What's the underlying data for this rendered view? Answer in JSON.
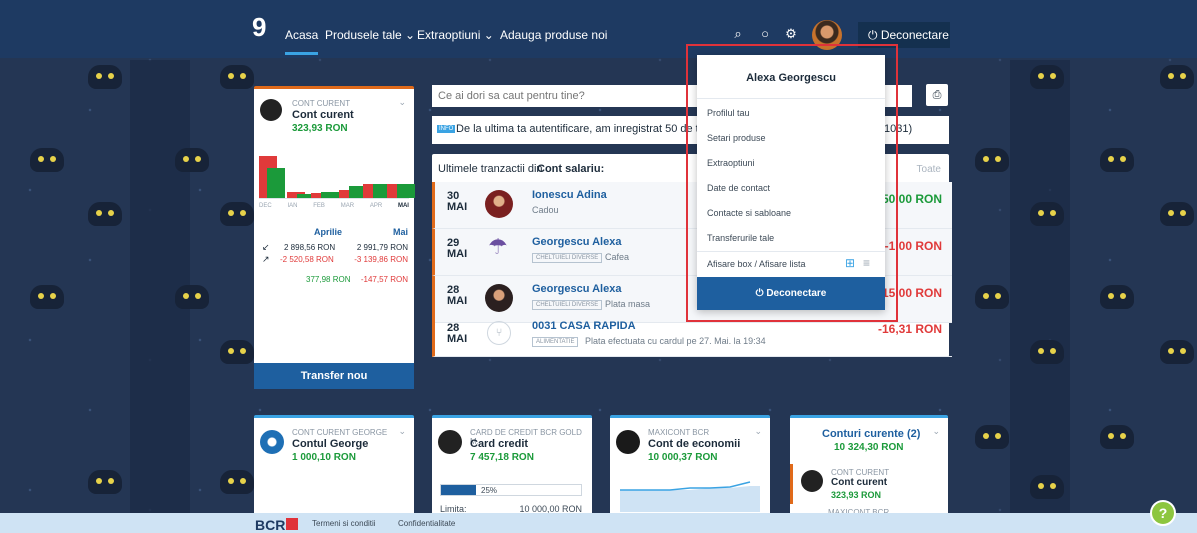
{
  "nav": {
    "home": "Acasa",
    "products": "Produsele tale ⌄",
    "extra": "Extraoptiuni ⌄",
    "add": "Adauga produse noi",
    "logout": "⏻ Deconectare"
  },
  "account": {
    "label": "CONT CURENT",
    "name": "Cont curent",
    "balance": "323,93 RON",
    "chart_months": [
      "DEC",
      "IAN",
      "FEB",
      "MAR",
      "APR",
      "MAI"
    ],
    "col1": "Aprilie",
    "col2": "Mai",
    "in1": "2 898,56 RON",
    "in2": "2 991,79 RON",
    "out1": "-2 520,58 RON",
    "out2": "-3 139,86 RON",
    "net1": "377,98 RON",
    "net2": "-147,57 RON",
    "transfer": "Transfer nou"
  },
  "search": {
    "placeholder": "Ce ai dori sa caut pentru tine?"
  },
  "info": {
    "tag": "INFO",
    "text": "De la ultima ta autentificare, am inregistrat 50 de tran",
    "tail": "1031)"
  },
  "tx": {
    "title_pre": "Ultimele tranzactii din ",
    "title_acc": "Cont salariu:",
    "all": "Toate",
    "rows": [
      {
        "day": "30",
        "month": "MAI",
        "name": "Ionescu Adina",
        "tag": "",
        "desc": "Cadou",
        "amount": "50,00 RON"
      },
      {
        "day": "29",
        "month": "MAI",
        "name": "Georgescu Alexa",
        "tag": "CHELTUIELI DIVERSE",
        "desc": "Cafea",
        "amount": "-1,00 RON"
      },
      {
        "day": "28",
        "month": "MAI",
        "name": "Georgescu Alexa",
        "tag": "CHELTUIELI DIVERSE",
        "desc": "Plata masa",
        "amount": "-15,00 RON"
      },
      {
        "day": "28",
        "month": "MAI",
        "name": "0031 CASA RAPIDA",
        "tag": "ALIMENTATIE",
        "desc": "Plata efectuata cu cardul pe 27. Mai. la 19:34",
        "amount": "-16,31 RON"
      }
    ]
  },
  "menu": {
    "user": "Alexa Georgescu",
    "items": [
      "Profilul tau",
      "Setari produse",
      "Extraoptiuni",
      "Date de contact",
      "Contacte si sabloane",
      "Transferurile tale",
      "Afisare box / Afisare lista"
    ],
    "logout": "⏻ Deconectare"
  },
  "cards": [
    {
      "label": "CONT CURENT GEORGE",
      "name": "Contul George",
      "balance": "1 000,10 RON"
    },
    {
      "label": "CARD DE CREDIT BCR GOLD M...",
      "name": "Card credit",
      "balance": "7 457,18 RON",
      "pct": "25%",
      "limit_label": "Limita:",
      "limit": "10 000,00 RON"
    },
    {
      "label": "MAXICONT BCR",
      "name": "Cont de economii",
      "balance": "10 000,37 RON"
    },
    {
      "label": "",
      "name": "Conturi curente (2)",
      "balance": "10 324,30 RON",
      "sub_label": "CONT CURENT",
      "sub_name": "Cont curent",
      "sub_balance": "323,93 RON",
      "sub2": "MAXICONT BCR"
    }
  ],
  "footer": {
    "brand": "BCR",
    "terms": "Termeni si conditii",
    "privacy": "Confidentialitate",
    "help": "?"
  },
  "colors": {
    "nav": "#1e3a62",
    "accent": "#3aa3e3",
    "green": "#1b9a3a",
    "red": "#e03a3a",
    "highlight": "#e0323a"
  }
}
